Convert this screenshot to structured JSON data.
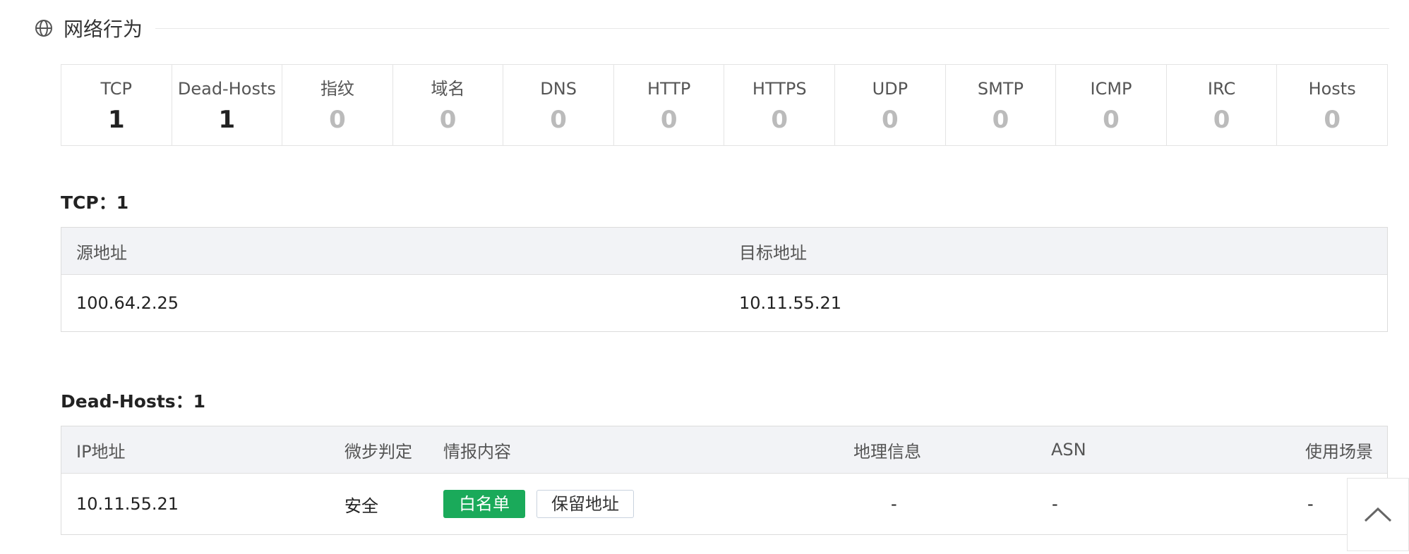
{
  "section": {
    "title": "网络行为",
    "icon": "globe-icon"
  },
  "stats": [
    {
      "label": "TCP",
      "value": "1",
      "active": true
    },
    {
      "label": "Dead-Hosts",
      "value": "1",
      "active": true
    },
    {
      "label": "指纹",
      "value": "0",
      "active": false
    },
    {
      "label": "域名",
      "value": "0",
      "active": false
    },
    {
      "label": "DNS",
      "value": "0",
      "active": false
    },
    {
      "label": "HTTP",
      "value": "0",
      "active": false
    },
    {
      "label": "HTTPS",
      "value": "0",
      "active": false
    },
    {
      "label": "UDP",
      "value": "0",
      "active": false
    },
    {
      "label": "SMTP",
      "value": "0",
      "active": false
    },
    {
      "label": "ICMP",
      "value": "0",
      "active": false
    },
    {
      "label": "IRC",
      "value": "0",
      "active": false
    },
    {
      "label": "Hosts",
      "value": "0",
      "active": false
    }
  ],
  "tcp": {
    "title": "TCP：1",
    "columns": [
      "源地址",
      "目标地址"
    ],
    "rows": [
      {
        "src": "100.64.2.25",
        "dst": "10.11.55.21"
      }
    ]
  },
  "dead_hosts": {
    "title": "Dead-Hosts：1",
    "columns": [
      "IP地址",
      "微步判定",
      "情报内容",
      "地理信息",
      "ASN",
      "使用场景"
    ],
    "rows": [
      {
        "ip": "10.11.55.21",
        "verdict": "安全",
        "intel_tags": [
          "白名单",
          "保留地址"
        ],
        "geo": "-",
        "asn": "-",
        "usage": "-"
      }
    ]
  },
  "colors": {
    "safe": "#2aa860",
    "whitelist_tag": "#1aaa5a",
    "header_bg": "#f2f3f6"
  },
  "back_to_top": {
    "icon": "chevron-up-icon"
  }
}
